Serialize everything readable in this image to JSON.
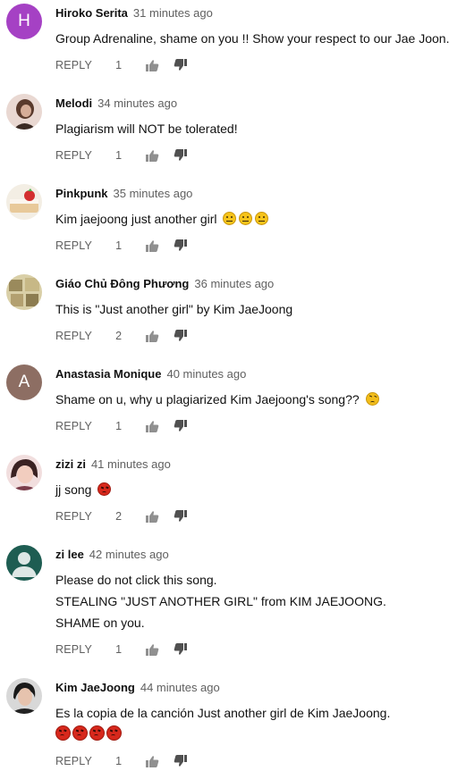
{
  "colors": {
    "author": "#111111",
    "meta": "#606060",
    "icon": "#909090",
    "avatar_h": "#a541c4",
    "avatar_a": "#8d6e63",
    "avatar_zilee": "#1e5d52"
  },
  "comments": [
    {
      "author": "Hiroko Serita",
      "time": "31 minutes ago",
      "avatar_letter": "H",
      "lines": [
        "Group Adrenaline, shame on you !! Show your respect to our Jae Joon."
      ],
      "reply_label": "REPLY",
      "likes": "1"
    },
    {
      "author": "Melodi",
      "time": "34 minutes ago",
      "lines": [
        "Plagiarism will NOT be tolerated!"
      ],
      "reply_label": "REPLY",
      "likes": "1"
    },
    {
      "author": "Pinkpunk",
      "time": "35 minutes ago",
      "lines": [
        "Kim jaejoong just another girl"
      ],
      "emoji": [
        "neutral-face",
        "neutral-face",
        "neutral-face"
      ],
      "reply_label": "REPLY",
      "likes": "1"
    },
    {
      "author": "Giáo Chủ Đông Phương",
      "time": "36 minutes ago",
      "lines": [
        "This is \"Just another girl\" by Kim JaeJoong"
      ],
      "reply_label": "REPLY",
      "likes": "2"
    },
    {
      "author": "Anastasia Monique",
      "time": "40 minutes ago",
      "avatar_letter": "A",
      "lines": [
        "Shame on u, why u plagiarized Kim Jaejoong's song??"
      ],
      "emoji": [
        "angry-face"
      ],
      "reply_label": "REPLY",
      "likes": "1"
    },
    {
      "author": "zizi zi",
      "time": "41 minutes ago",
      "lines": [
        "jj song"
      ],
      "emoji": [
        "pouting-face"
      ],
      "reply_label": "REPLY",
      "likes": "2"
    },
    {
      "author": "zi lee",
      "time": "42 minutes ago",
      "lines": [
        "Please do not click this song.",
        "STEALING \"JUST ANOTHER GIRL\" from KIM JAEJOONG.",
        "SHAME on you."
      ],
      "reply_label": "REPLY",
      "likes": "1"
    },
    {
      "author": "Kim JaeJoong",
      "time": "44 minutes ago",
      "lines": [
        "Es la copia de la canción Just another girl de Kim JaeJoong."
      ],
      "emoji_line": [
        "pouting-face",
        "pouting-face",
        "pouting-face",
        "pouting-face"
      ],
      "reply_label": "REPLY",
      "likes": "1"
    }
  ]
}
